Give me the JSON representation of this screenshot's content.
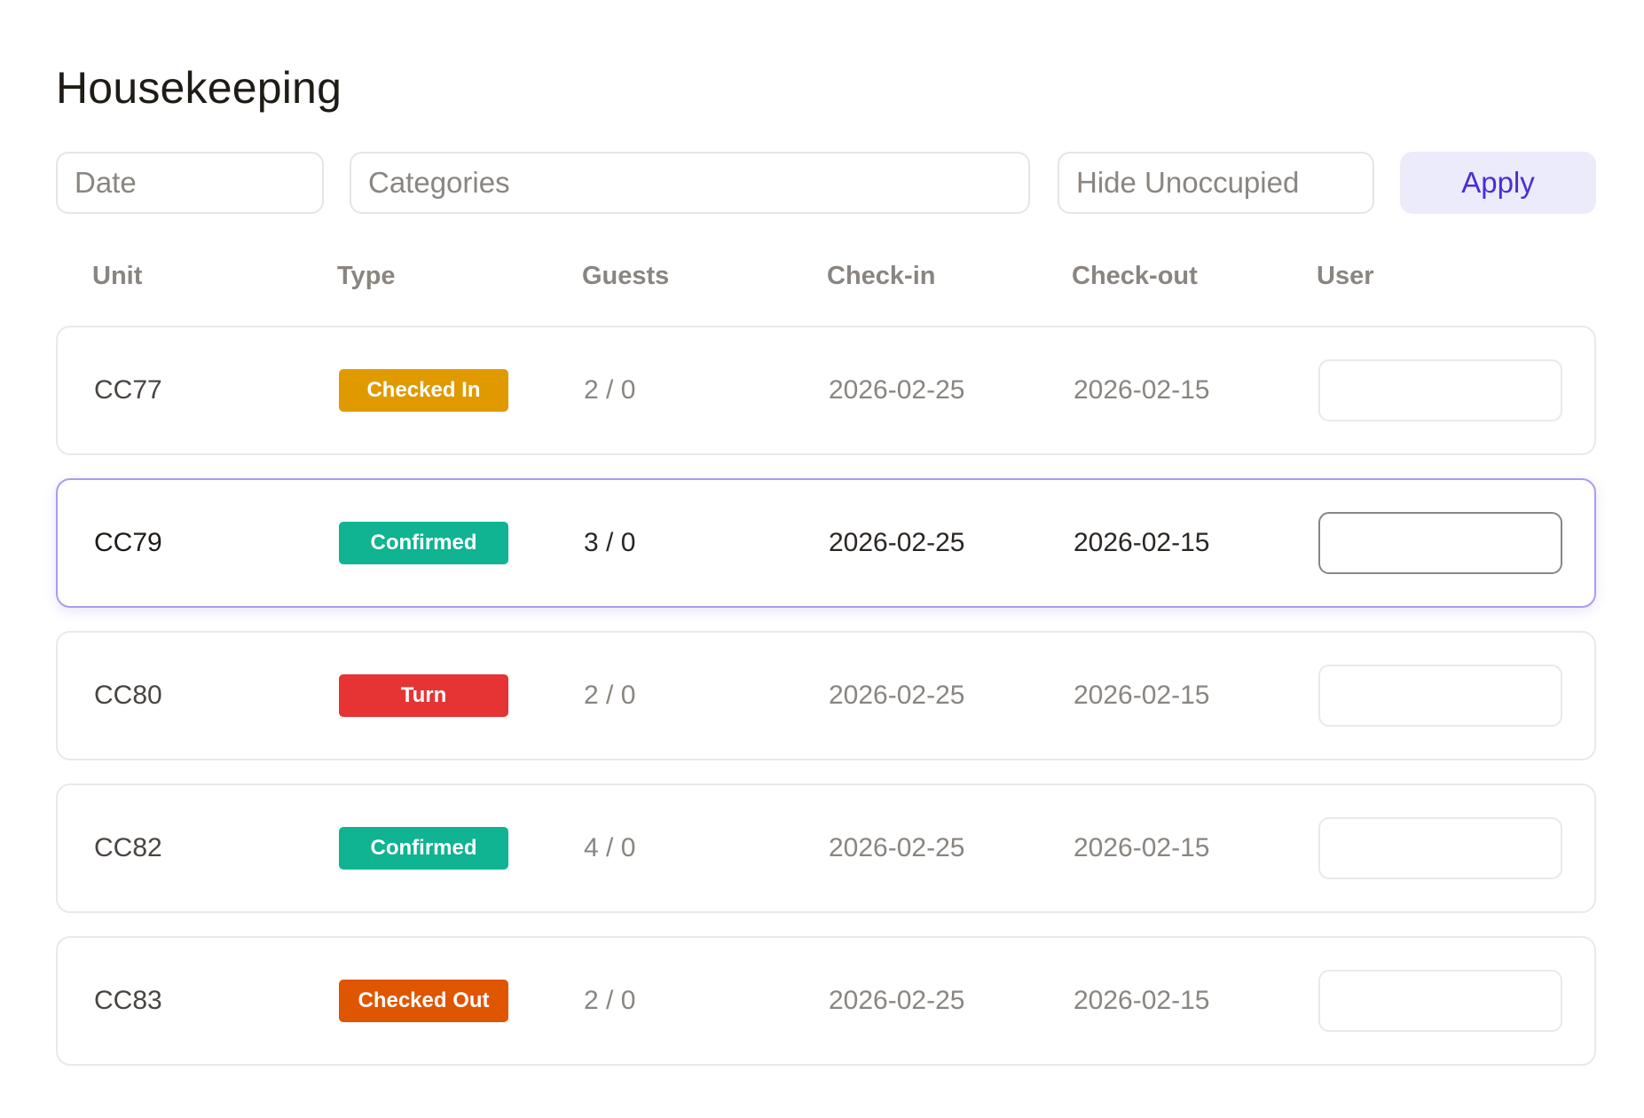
{
  "page": {
    "title": "Housekeeping"
  },
  "filters": {
    "date_placeholder": "Date",
    "categories_placeholder": "Categories",
    "hide_unoccupied_placeholder": "Hide Unoccupied",
    "apply_label": "Apply"
  },
  "table": {
    "columns": [
      "Unit",
      "Type",
      "Guests",
      "Check-in",
      "Check-out",
      "User"
    ],
    "rows": [
      {
        "unit": "CC77",
        "type": "Checked In",
        "type_color": "#e09a00",
        "guests": "2 / 0",
        "check_in": "2026-02-25",
        "check_out": "2026-02-15",
        "user": "",
        "selected": false
      },
      {
        "unit": "CC79",
        "type": "Confirmed",
        "type_color": "#10b392",
        "guests": "3 / 0",
        "check_in": "2026-02-25",
        "check_out": "2026-02-15",
        "user": "",
        "selected": true
      },
      {
        "unit": "CC80",
        "type": "Turn",
        "type_color": "#e63333",
        "guests": "2 / 0",
        "check_in": "2026-02-25",
        "check_out": "2026-02-15",
        "user": "",
        "selected": false
      },
      {
        "unit": "CC82",
        "type": "Confirmed",
        "type_color": "#10b392",
        "guests": "4 / 0",
        "check_in": "2026-02-25",
        "check_out": "2026-02-15",
        "user": "",
        "selected": false
      },
      {
        "unit": "CC83",
        "type": "Checked Out",
        "type_color": "#e05500",
        "guests": "2 / 0",
        "check_in": "2026-02-25",
        "check_out": "2026-02-15",
        "user": "",
        "selected": false
      }
    ]
  },
  "colors": {
    "accent": "#4530d6",
    "apply_bg": "#ecebfc",
    "selected_border": "#a69ef0"
  }
}
